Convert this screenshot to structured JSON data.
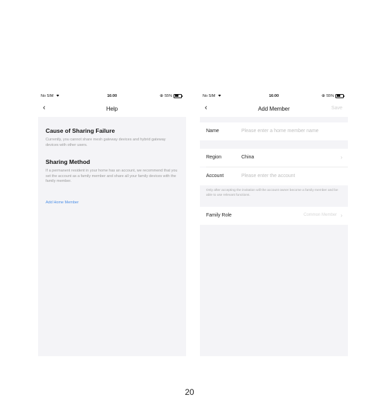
{
  "status_bar": {
    "carrier": "No SIM",
    "time": "16:00",
    "battery": "55%"
  },
  "help_screen": {
    "title": "Help",
    "sections": [
      {
        "heading": "Cause of Sharing Failure",
        "body": "Currently, you cannot share mesh gateway devices and hybrid gateway devices with other users."
      },
      {
        "heading": "Sharing Method",
        "body": "If a permanent resident in your home has an account, we recommend that you set the account as a family member and share all your family devices with the family member."
      }
    ],
    "link": "Add Home Member"
  },
  "add_member_screen": {
    "title": "Add Member",
    "save_label": "Save",
    "name": {
      "label": "Name",
      "placeholder": "Please enter a home member name"
    },
    "region": {
      "label": "Region",
      "value": "China"
    },
    "account": {
      "label": "Account",
      "placeholder": "Please enter the account"
    },
    "note": "Only after accepting the invitation will the account owner become a family member and be able to use relevant functions.",
    "family_role": {
      "label": "Family Role",
      "value": "Common Member"
    }
  },
  "page_number": "20",
  "icons": {
    "back": "chevron-left-icon",
    "wifi": "wifi-icon",
    "battery": "battery-icon",
    "chevron": "chevron-right-icon"
  }
}
